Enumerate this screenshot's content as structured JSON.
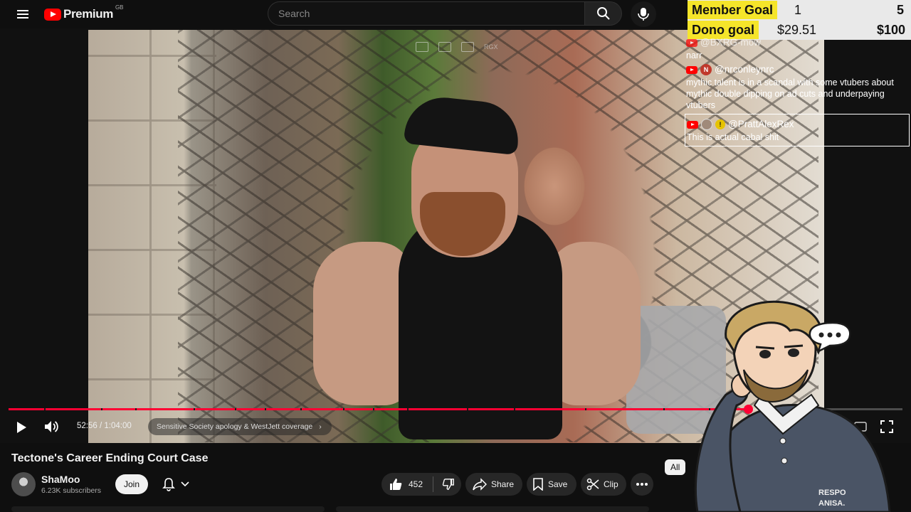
{
  "header": {
    "brand": "Premium",
    "country": "GB",
    "search_placeholder": "Search"
  },
  "player": {
    "current_time": "52:56",
    "duration": "1:04:00",
    "time_display": "52:56 / 1:04:00",
    "progress_fraction": 0.827,
    "chapter_label": "Sensitive Society apology & WestJett coverage",
    "overlay_icons": [
      "miniplayer-icon",
      "theater-icon",
      "next-icon"
    ],
    "overlay_tag": "RGX"
  },
  "overlay": {
    "goals": [
      {
        "label": "Member Goal",
        "current": "1",
        "target": "5"
      },
      {
        "label": "Dono goal",
        "current": "$29.51",
        "target": "$100"
      }
    ],
    "chat": [
      {
        "user": "@BXRG-mow",
        "text": "narr"
      },
      {
        "user": "@nrconleynrc",
        "badge": "N",
        "text": "mythic talent is in a scandal with some vtubers about mythic double dipping on ad cuts and underpaying vtubers"
      },
      {
        "user": "@PrattAlexRex",
        "text": "This is actual cabal shit"
      }
    ]
  },
  "video": {
    "title": "Tectone's Career Ending Court Case",
    "channel": "ShaMoo",
    "subscribers": "6.23K subscribers",
    "join_label": "Join",
    "likes": "452",
    "share_label": "Share",
    "save_label": "Save",
    "clip_label": "Clip",
    "chip_all": "All"
  },
  "vtuber": {
    "caption_lines": [
      "RESPO",
      "ANISA."
    ]
  },
  "colors": {
    "accent": "#ff0033",
    "brand_red": "#ff0000",
    "goal_highlight": "#f5e52a",
    "background": "#0f0f0f"
  }
}
